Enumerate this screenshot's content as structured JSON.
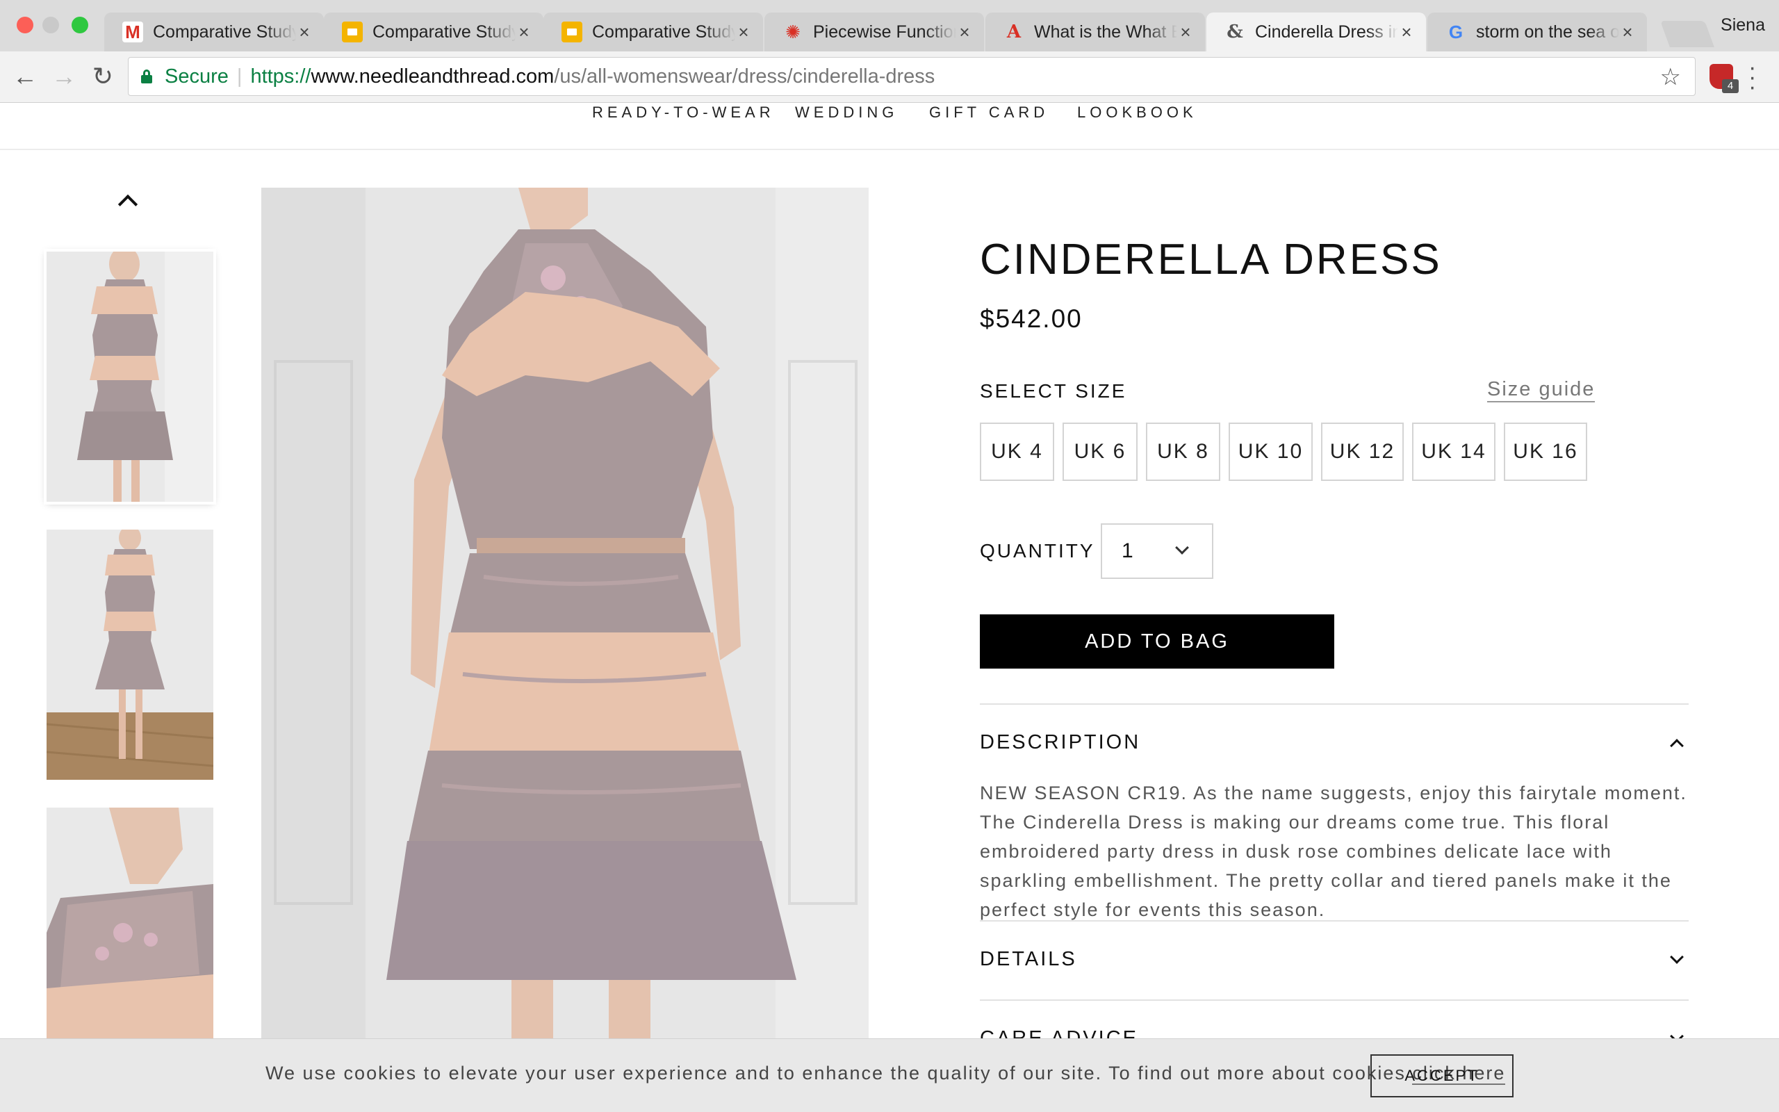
{
  "browser": {
    "tabs": [
      {
        "title": "Comparative Study of",
        "icon": "gmail-icon"
      },
      {
        "title": "Comparative Study of",
        "icon": "google-slides-icon"
      },
      {
        "title": "Comparative Study of",
        "icon": "google-slides-icon"
      },
      {
        "title": "Piecewise Functions",
        "icon": "piecewise-site-icon"
      },
      {
        "title": "What is the What Era",
        "icon": "a-plus-icon"
      },
      {
        "title": "Cinderella Dress in Dusk",
        "icon": "ampersand-icon",
        "active": true
      },
      {
        "title": "storm on the sea of",
        "icon": "google-icon"
      }
    ],
    "close_glyph": "×",
    "profile_name": "Siena",
    "extension_badge": "4",
    "address": {
      "secure_label": "Secure",
      "scheme": "https://",
      "host": "www.needleandthread.com",
      "path": "/us/all-womenswear/dress/cinderella-dress"
    }
  },
  "site_nav": [
    "READY-TO-WEAR",
    "WEDDING",
    "GIFT CARD",
    "LOOKBOOK"
  ],
  "product": {
    "title": "CINDERELLA DRESS",
    "price": "$542.00",
    "select_size_label": "SELECT SIZE",
    "size_guide_label": "Size guide",
    "sizes": [
      "UK 4",
      "UK 6",
      "UK 8",
      "UK 10",
      "UK 12",
      "UK 14",
      "UK 16"
    ],
    "quantity_label": "QUANTITY",
    "quantity_value": "1",
    "add_to_bag_label": "ADD TO BAG",
    "accordion": {
      "description_title": "DESCRIPTION",
      "description_text": "NEW SEASON CR19. As the name suggests, enjoy this fairytale moment. The Cinderella Dress is making our dreams come true. This floral embroidered party dress in dusk rose combines delicate lace with sparkling embellishment. The pretty collar and tiered panels make it the perfect style for events this season.",
      "details_title": "DETAILS",
      "care_title": "CARE ADVICE"
    }
  },
  "cookie_bar": {
    "text": "We use cookies to elevate your user experience and to enhance the quality of our site. To find out more about cookies ",
    "link_text": "click here",
    "accept_label": "ACCEPT"
  },
  "colors": {
    "dress_lilac": "#a8989a",
    "dress_peach": "#e8c3ad",
    "backdrop": "#e9e9e9",
    "floor": "#a98660",
    "brand_black": "#000000",
    "secure_green": "#0b8043"
  }
}
